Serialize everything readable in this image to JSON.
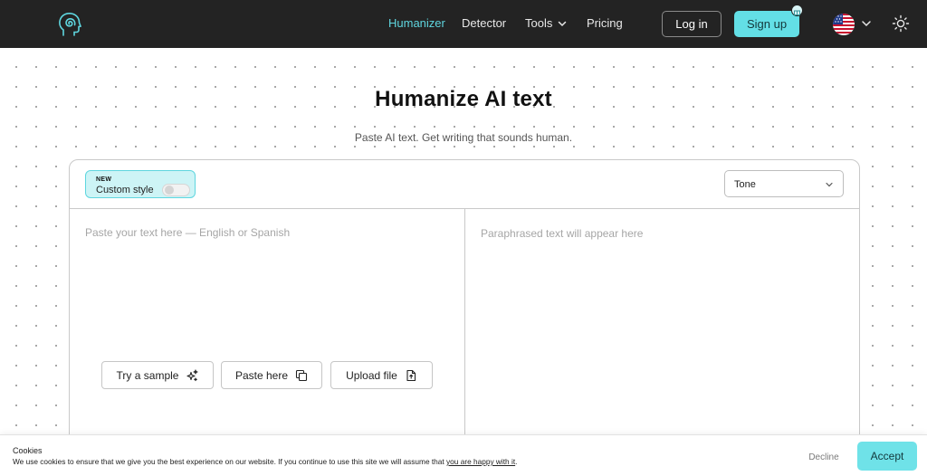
{
  "nav": {
    "logo_icon": "head-spiral-logo-icon",
    "links": [
      {
        "label": "Humanizer",
        "active": true
      },
      {
        "label": "Detector",
        "active": false
      },
      {
        "label": "Tools",
        "active": false
      },
      {
        "label": "Pricing",
        "active": false
      }
    ],
    "login_label": "Log in",
    "signup_label": "Sign up",
    "language_icon": "us-flag-icon",
    "theme_icon": "sun-icon",
    "accent_color": "#63dfe6",
    "bar_color": "#232323"
  },
  "hero": {
    "title": "Humanize AI text",
    "subtitle": "Paste AI text. Get writing that sounds human."
  },
  "editor": {
    "new_badge": "NEW",
    "custom_style_label": "Custom style",
    "custom_style_enabled": false,
    "tone_label": "Tone",
    "input_placeholder": "Paste your text here — English or Spanish",
    "output_placeholder": "Paraphrased text will appear here",
    "actions": {
      "sample_label": "Try a sample",
      "paste_label": "Paste here",
      "upload_label": "Upload file"
    }
  },
  "cookies": {
    "title": "Cookies",
    "text": "We use cookies to ensure that we give you the best experience on our website. If you continue to use this site we will assume that ",
    "link_text": "you are happy with it",
    "text_end": ".",
    "decline_label": "Decline",
    "accept_label": "Accept"
  }
}
